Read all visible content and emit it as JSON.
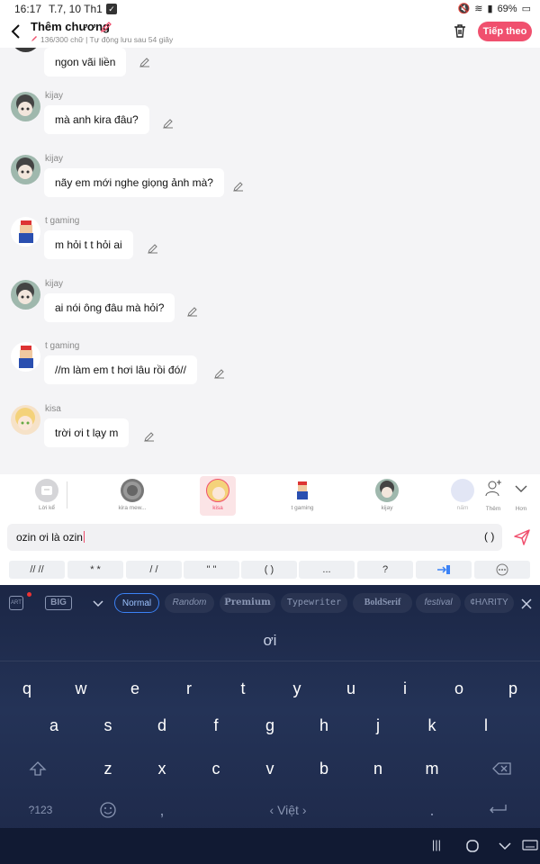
{
  "status": {
    "time": "16:17",
    "date": "T.7, 10 Th1",
    "battery": "69%"
  },
  "header": {
    "title": "Thêm chương",
    "subtitle": "136/300 chữ | Tự động lưu sau 54 giây",
    "next_label": "Tiếp theo"
  },
  "messages": [
    {
      "author": "",
      "text": "ngon vãi liền"
    },
    {
      "author": "kijay",
      "text": "mà anh kira đâu?"
    },
    {
      "author": "kijay",
      "text": "nãy em mới nghe giọng ảnh mà?"
    },
    {
      "author": "t gaming",
      "text": "m hỏi t t hỏi ai"
    },
    {
      "author": "kijay",
      "text": "ai nói ông đâu mà hỏi?"
    },
    {
      "author": "t gaming",
      "text": "//m làm em t hơi lâu rồi đó//"
    },
    {
      "author": "kisa",
      "text": "trời ơi t lạy m"
    }
  ],
  "characters": [
    {
      "name": "Lời kể"
    },
    {
      "name": "kira mew..."
    },
    {
      "name": "kisa"
    },
    {
      "name": "t gaming"
    },
    {
      "name": "kijay"
    },
    {
      "name": "nấm"
    }
  ],
  "more": {
    "add_label": "Thêm",
    "more_label": "Hơn"
  },
  "input": {
    "value": "ozin ơi là ozin",
    "paren": "( )"
  },
  "chips": [
    "// //",
    "* *",
    "/ /",
    "\" \"",
    "( )",
    "...",
    "?",
    "",
    ""
  ],
  "keyboard": {
    "styles": [
      "Normal",
      "Random",
      "Premium",
      "Typewriter",
      "BoldSerif",
      "festival",
      "¢HΛRITY"
    ],
    "big_label": "BIG",
    "art_label": "ART",
    "suggestion": "ơi",
    "row1": [
      "q",
      "w",
      "e",
      "r",
      "t",
      "y",
      "u",
      "i",
      "o",
      "p"
    ],
    "row2": [
      "a",
      "s",
      "d",
      "f",
      "g",
      "h",
      "j",
      "k",
      "l"
    ],
    "row3": [
      "z",
      "x",
      "c",
      "v",
      "b",
      "n",
      "m"
    ],
    "num_label": "?123",
    "comma": ",",
    "space_label": "Việt",
    "period": "."
  },
  "colors": {
    "accent": "#f0506e",
    "keyboard_bg": "#1d2848"
  }
}
